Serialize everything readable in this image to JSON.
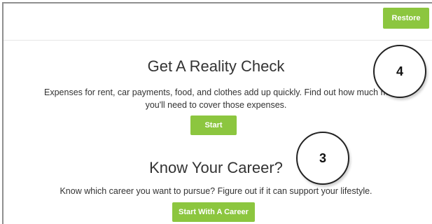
{
  "header": {
    "restore_label": "Restore"
  },
  "reality_check": {
    "title": "Get A Reality Check",
    "description_line1": "Expenses for rent, car payments, food, and clothes add up quickly. Find out how much m",
    "description_line2": "you'll need to cover those expenses.",
    "start_label": "Start"
  },
  "career": {
    "title": "Know Your Career?",
    "description": "Know which career you want to pursue? Figure out if it can support your lifestyle.",
    "start_label": "Start With A Career"
  },
  "callouts": {
    "four": "4",
    "three": "3"
  },
  "colors": {
    "accent": "#8cc63f",
    "text": "#333333"
  }
}
